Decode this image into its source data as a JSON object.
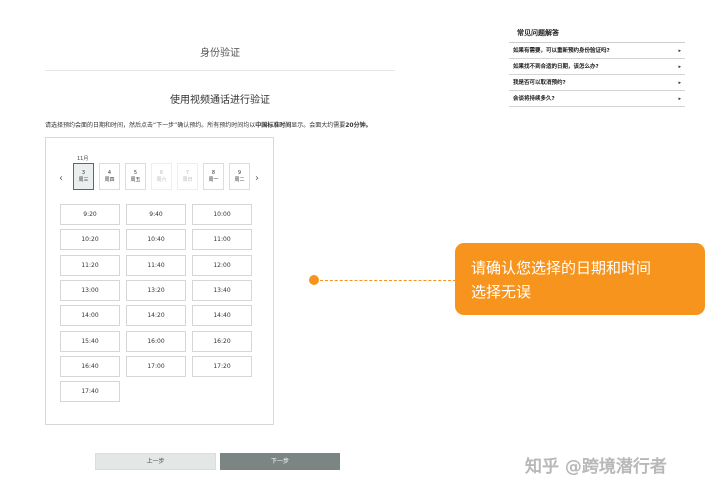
{
  "page": {
    "title": "身份验证",
    "section_title": "使用视频通话进行验证",
    "instruction_prefix": "请选择预约会面的日期和时间，然后点击“下一步”确认预约。所有预约时间均以",
    "instruction_bold_1": "中国标准时间",
    "instruction_mid": "显示。会面大约需要",
    "instruction_bold_2": "20分钟。"
  },
  "calendar": {
    "month_label": "11月",
    "prev_arrow": "‹",
    "next_arrow": "›",
    "dates": [
      {
        "day": "3",
        "weekday": "周三",
        "state": "selected"
      },
      {
        "day": "4",
        "weekday": "周四",
        "state": "normal"
      },
      {
        "day": "5",
        "weekday": "周五",
        "state": "normal"
      },
      {
        "day": "6",
        "weekday": "周六",
        "state": "disabled"
      },
      {
        "day": "7",
        "weekday": "周日",
        "state": "disabled"
      },
      {
        "day": "8",
        "weekday": "周一",
        "state": "normal"
      },
      {
        "day": "9",
        "weekday": "周二",
        "state": "normal"
      }
    ]
  },
  "time_slots": [
    "9:20",
    "9:40",
    "10:00",
    "10:20",
    "10:40",
    "11:00",
    "11:20",
    "11:40",
    "12:00",
    "13:00",
    "13:20",
    "13:40",
    "14:00",
    "14:20",
    "14:40",
    "15:40",
    "16:00",
    "16:20",
    "16:40",
    "17:00",
    "17:20",
    "17:40"
  ],
  "buttons": {
    "prev_label": "上一步",
    "next_label": "下一步"
  },
  "faq": {
    "title": "常见问题解答",
    "items": [
      "如果有需要，可以重新预约身份验证吗?",
      "如果找不到合适的日期，该怎么办?",
      "我是否可以取消预约?",
      "会谈将持续多久?"
    ],
    "arrow": "▸"
  },
  "annotation": {
    "line1": "请确认您选择的日期和时间",
    "line2": "选择无误",
    "color": "#f7941d"
  },
  "watermark": "知乎 @跨境潜行者"
}
